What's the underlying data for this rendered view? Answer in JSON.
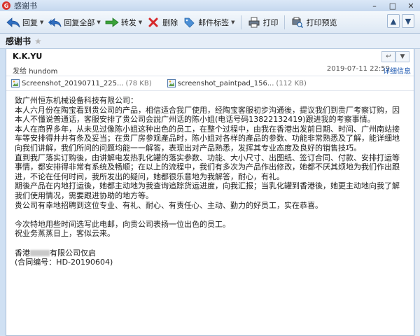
{
  "window": {
    "title": "感谢书",
    "logo_glyph": "G",
    "minimize_glyph": "–",
    "maximize_glyph": "□",
    "close_glyph": "✕"
  },
  "toolbar": {
    "reply": "回复",
    "reply_all": "回复全部",
    "forward": "转发",
    "delete": "删除",
    "tag": "邮件标签",
    "print": "打印",
    "print_preview": "打印预览",
    "prev_glyph": "▲",
    "next_glyph": "▼",
    "caret": "▼"
  },
  "message": {
    "subject": "感谢书",
    "star_glyph": "★",
    "sender": "K.K.YU",
    "to_label": "发给",
    "to": "hundom",
    "date": "2019-07-11 22:59",
    "details_link": "详细信息",
    "reply_glyph": "↩",
    "menu_glyph": "▼",
    "attachments": [
      {
        "name": "Screenshot_20190711_225...",
        "size": "(78 KB)"
      },
      {
        "name": "screenshot_paintpad_156...",
        "size": "(112 KB)"
      }
    ],
    "body": {
      "greeting": "致广州恒东机械设备科技有限公司：",
      "p1": "本人六月份在陶宝看到贵公司的产品，相信适合我厂使用，经陶宝客服初步沟通後，提议我们到贵厂考察订购，因本人不懂说普通话，客服安排了贵公司会說广州话的陈小姐(电话号码13822132419)跟进我的考察事情。",
      "p2": "本人在商界多年，从未见过像陈小姐这种出色的员工，在整个过程中，由我在香港出发前日期、时间、广州南站接车等安排得井井有条及妥当；在贵厂房参观產品时，陈小姐对各样的產品的参数、功能非常熟悉及了解，能详细地向我们讲解，我们所问的问题均能一一解答，表现出对产品熟悉，发挥其专业态度及良好的销售技巧。",
      "p3": "直到我厂落实订购後，由讲解电发热乳化罐的落实参数、功能、大小尺寸、出图纸、签订合同、付款、安排打运等事情，都安排得非常有系统及畅顺；在以上的流程中，我们有多次为产品作出修改，她都不厌其烦地为我们作出跟进，不论在任何时间，我所发出的疑问，她都很乐意地为我解答，耐心，有礼。",
      "p4": "期後产品在内地打运後，她都主动地为我查询追踪货运进度，向我汇报；当乳化罐到香港後，她更主动地向我了解我们使用情况，需要跟进协助的地方等。",
      "p5": "贵公司有幸地招聘到这位专业、有礼、耐心、有责任心、主动、勤力的好员工，实在恭喜。",
      "p6": "今次特地用些时间选写此电邮，向贵公司表扬一位出色的员工。",
      "p7": "祝业务蒸蒸日上，客似云来。",
      "sig_prefix": "香港",
      "sig_suffix": "有限公司仅启",
      "contract": "(合同编号：HD-20190604)"
    }
  }
}
